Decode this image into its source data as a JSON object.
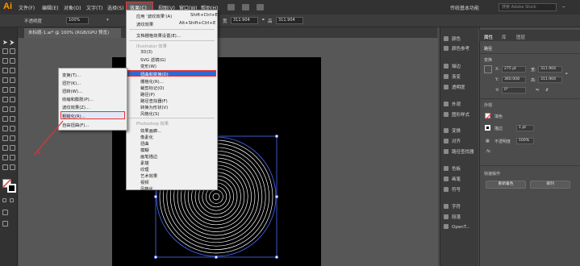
{
  "app": {
    "logo": "Ai"
  },
  "menubar": {
    "items": [
      "文件(F)",
      "编辑(E)",
      "对象(O)",
      "文字(T)",
      "选择(S)",
      "效果(C)",
      "视图(V)",
      "窗口(W)",
      "帮助(H)"
    ],
    "workspace": "传统基本功能",
    "search_placeholder": "搜索 Adobe Stock"
  },
  "controlbar": {
    "opacity_label": "不透明度",
    "opacity_value": "100%",
    "width_label": "宽",
    "width_value": "311.904",
    "height_label": "高",
    "height_value": "311.904"
  },
  "document": {
    "tab_title": "未标题-1.ai* @ 100% (RGB/GPU 预览)"
  },
  "effect_menu": {
    "items": [
      {
        "label": "应用 '波纹效果'(A)",
        "shortcut": "Shift+Ctrl+E"
      },
      {
        "label": "波纹效果",
        "shortcut": "Alt+Shift+Ctrl+E"
      },
      {
        "label": "文档栅格效果设置(E)...",
        "shortcut": ""
      }
    ],
    "section_illustrator": "Illustrator 效果",
    "illustrator_items": [
      "3D(3)",
      "SVG 滤镜(G)",
      "变形(W)",
      "扭曲和变换(D)",
      "栅格化(R)...",
      "裁剪标记(O)",
      "路径(P)",
      "路径查找器(F)",
      "转换为形状(V)",
      "风格化(S)"
    ],
    "section_photoshop": "Photoshop 效果",
    "photoshop_items": [
      "效果画廊...",
      "像素化",
      "扭曲",
      "模糊",
      "画笔描边",
      "素描",
      "纹理",
      "艺术效果",
      "视频",
      "风格化"
    ]
  },
  "distort_submenu": {
    "items": [
      "变换(T)...",
      "扭拧(K)...",
      "扭转(W)...",
      "收缩和膨胀(P)...",
      "波纹效果(Z)...",
      "粗糙化(R)...",
      "自由扭曲(F)..."
    ],
    "highlighted": "粗糙化(R)..."
  },
  "dock": {
    "items": [
      "颜色",
      "颜色参考",
      "描边",
      "渐变",
      "透明度",
      "外观",
      "图形样式",
      "变换",
      "对齐",
      "路径查找器",
      "色板",
      "画笔",
      "符号",
      "字符",
      "段落",
      "OpenT..."
    ]
  },
  "properties": {
    "tabs": [
      "属性",
      "库",
      "图层"
    ],
    "section_object": "路径",
    "transform_label": "变换",
    "x": "275 pt",
    "y": "360.008",
    "w": "311.904",
    "h": "311.904",
    "angle": "0°",
    "appearance_label": "外观",
    "fill_label": "填色",
    "stroke_label": "描边",
    "stroke_value": "1 pt",
    "opacity_label": "不透明度",
    "opacity_value": "100%",
    "fx_label": "fx.",
    "quick_actions_label": "快速操作",
    "btn_recolor": "重新着色",
    "btn_arrange": "排列"
  },
  "colors": {
    "accent": "#2f6ad0",
    "annotation": "#e33333",
    "artwork_stroke": "#ffffff",
    "selection": "#4a6cff"
  }
}
